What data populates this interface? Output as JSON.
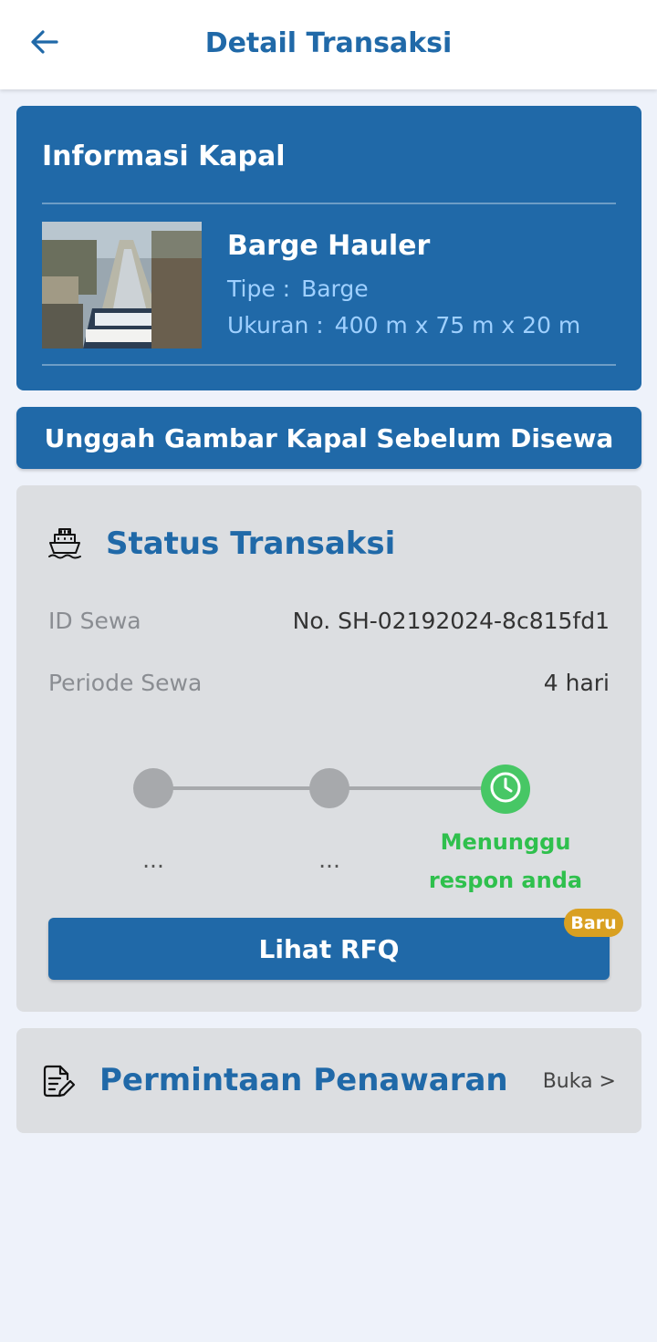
{
  "header": {
    "title": "Detail Transaksi",
    "back_icon": "arrow-left-icon"
  },
  "ship": {
    "section_title": "Informasi Kapal",
    "name": "Barge Hauler",
    "type_label": "Tipe :",
    "type_value": "Barge",
    "size_label": "Ukuran :",
    "size_value": "400 m x 75 m x 20 m"
  },
  "upload": {
    "label": "Unggah Gambar Kapal Sebelum Disewa"
  },
  "status": {
    "title": "Status Transaksi",
    "icon": "ship-icon",
    "rows": [
      {
        "label": "ID Sewa",
        "value": "No. SH-02192024-8c815fd1"
      },
      {
        "label": "Periode Sewa",
        "value": "4 hari"
      }
    ],
    "steps": [
      {
        "label": "...",
        "state": "inactive"
      },
      {
        "label": "...",
        "state": "inactive"
      },
      {
        "label": "Menunggu respon anda",
        "state": "active"
      }
    ],
    "rfq_button": "Lihat RFQ",
    "badge": "Baru"
  },
  "rfq_section": {
    "title": "Permintaan Penawaran",
    "icon": "document-edit-icon",
    "link": "Buka  >"
  },
  "colors": {
    "primary": "#2069a8",
    "active_step": "#47c765",
    "badge": "#d9a021",
    "card_gray": "#dcdee1",
    "background": "#eef2fa"
  }
}
